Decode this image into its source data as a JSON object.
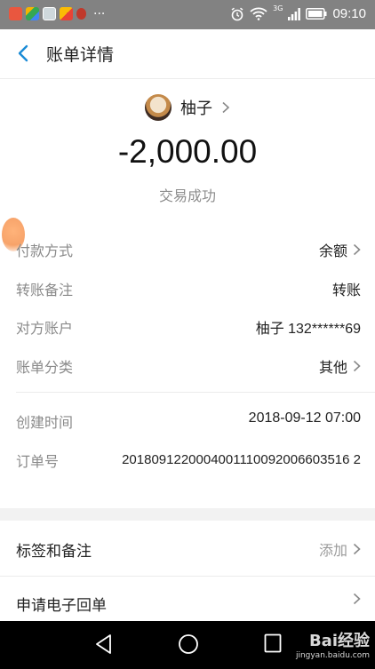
{
  "status_bar": {
    "time": "09:10",
    "more": "···",
    "network": "3G"
  },
  "header": {
    "title": "账单详情"
  },
  "transaction": {
    "payee_name": "柚子",
    "amount": "-2,000.00",
    "status": "交易成功"
  },
  "details": [
    {
      "label": "付款方式",
      "value": "余额",
      "chevron": true
    },
    {
      "label": "转账备注",
      "value": "转账",
      "chevron": false
    },
    {
      "label": "对方账户",
      "value": "柚子 132******69",
      "chevron": false
    },
    {
      "label": "账单分类",
      "value": "其他",
      "chevron": true
    }
  ],
  "meta": [
    {
      "label": "创建时间",
      "value": "2018-09-12 07:00"
    },
    {
      "label": "订单号",
      "value": "2018091220004001110092006603516 2"
    }
  ],
  "actions": {
    "tags": {
      "label": "标签和备注",
      "action": "添加"
    },
    "receipt": {
      "label": "申请电子回单"
    }
  },
  "watermark": {
    "brand": "Bai经验",
    "url": "jingyan.baidu.com"
  },
  "colors": {
    "accent": "#1a8bd6",
    "status_bar": "#828282",
    "nav_bar": "#000000"
  }
}
